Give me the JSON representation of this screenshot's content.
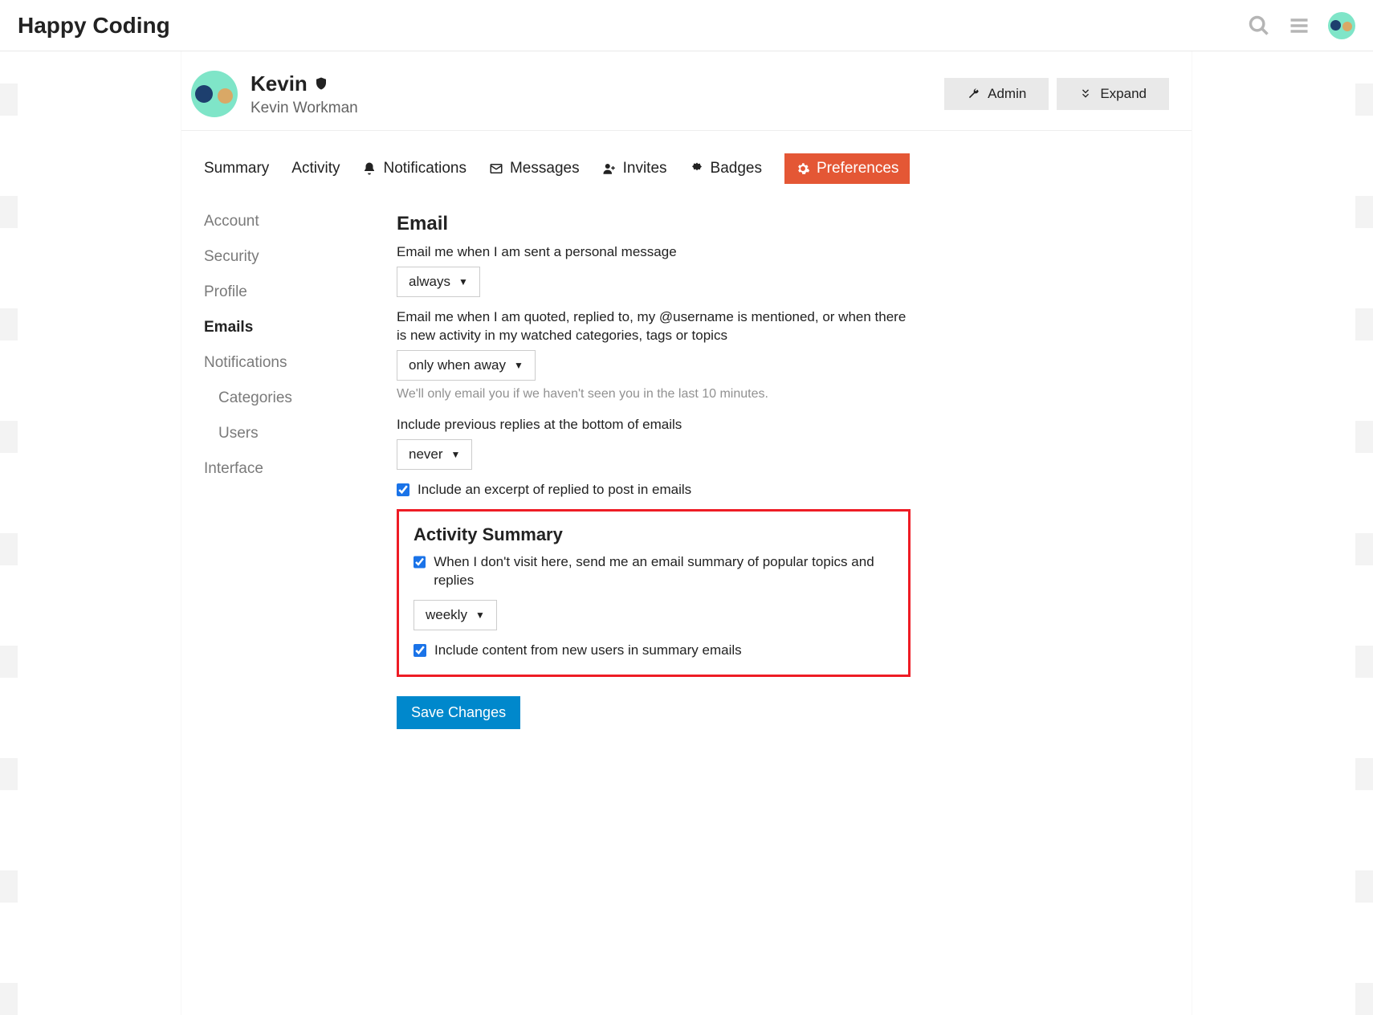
{
  "header": {
    "site_title": "Happy Coding"
  },
  "profile": {
    "username": "Kevin",
    "realname": "Kevin Workman",
    "admin_label": "Admin",
    "expand_label": "Expand"
  },
  "tabs": {
    "summary": "Summary",
    "activity": "Activity",
    "notifications": "Notifications",
    "messages": "Messages",
    "invites": "Invites",
    "badges": "Badges",
    "preferences": "Preferences"
  },
  "sidebar": {
    "account": "Account",
    "security": "Security",
    "profile": "Profile",
    "emails": "Emails",
    "notifications": "Notifications",
    "categories": "Categories",
    "users": "Users",
    "interface": "Interface"
  },
  "email": {
    "section_title": "Email",
    "pm_label": "Email me when I am sent a personal message",
    "pm_value": "always",
    "quoted_label": "Email me when I am quoted, replied to, my @username is mentioned, or when there is new activity in my watched categories, tags or topics",
    "quoted_value": "only when away",
    "quoted_hint": "We'll only email you if we haven't seen you in the last 10 minutes.",
    "previous_label": "Include previous replies at the bottom of emails",
    "previous_value": "never",
    "excerpt_label": "Include an excerpt of replied to post in emails"
  },
  "activity_summary": {
    "title": "Activity Summary",
    "digest_label": "When I don't visit here, send me an email summary of popular topics and replies",
    "digest_value": "weekly",
    "new_users_label": "Include content from new users in summary emails"
  },
  "save_label": "Save Changes"
}
